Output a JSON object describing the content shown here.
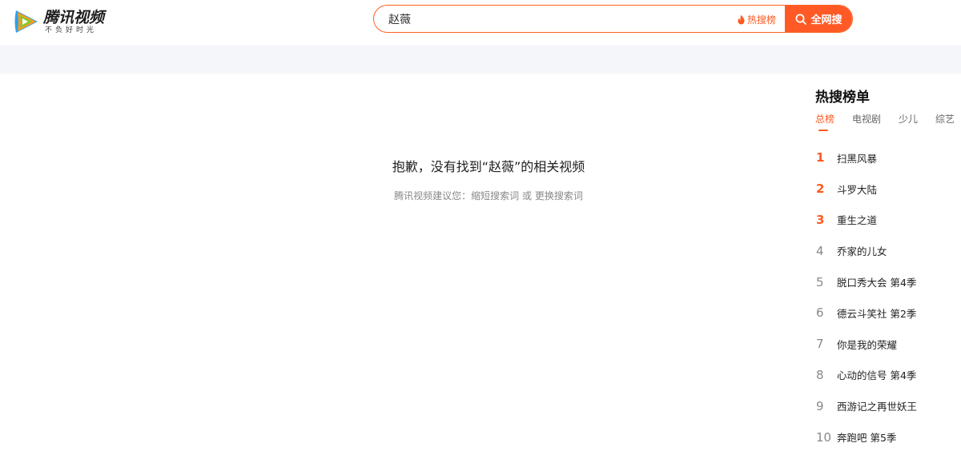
{
  "header": {
    "logo": {
      "title": "腾讯视频",
      "slogan": "不负好时光"
    },
    "search": {
      "query": "赵薇",
      "hot_link": "热搜榜",
      "button": "全网搜"
    }
  },
  "empty_state": {
    "title": "抱歉，没有找到“赵薇”的相关视频",
    "suggestion_prefix": "腾讯视频建议您：",
    "suggestion_1": "缩短搜索词",
    "suggestion_or": " 或 ",
    "suggestion_2": "更换搜索词"
  },
  "hot_ranking": {
    "title": "热搜榜单",
    "tabs": [
      {
        "label": "总榜",
        "active": true
      },
      {
        "label": "电视剧",
        "active": false
      },
      {
        "label": "少儿",
        "active": false
      },
      {
        "label": "综艺",
        "active": false
      }
    ],
    "items": [
      {
        "rank": "1",
        "name": "扫黑风暴"
      },
      {
        "rank": "2",
        "name": "斗罗大陆"
      },
      {
        "rank": "3",
        "name": "重生之道"
      },
      {
        "rank": "4",
        "name": "乔家的儿女"
      },
      {
        "rank": "5",
        "name": "脱口秀大会 第4季"
      },
      {
        "rank": "6",
        "name": "德云斗笑社 第2季"
      },
      {
        "rank": "7",
        "name": "你是我的荣耀"
      },
      {
        "rank": "8",
        "name": "心动的信号 第4季"
      },
      {
        "rank": "9",
        "name": "西游记之再世妖王"
      },
      {
        "rank": "10",
        "name": "奔跑吧 第5季"
      }
    ]
  },
  "colors": {
    "accent": "#ff5a1f",
    "band": "#f5f6fa"
  }
}
